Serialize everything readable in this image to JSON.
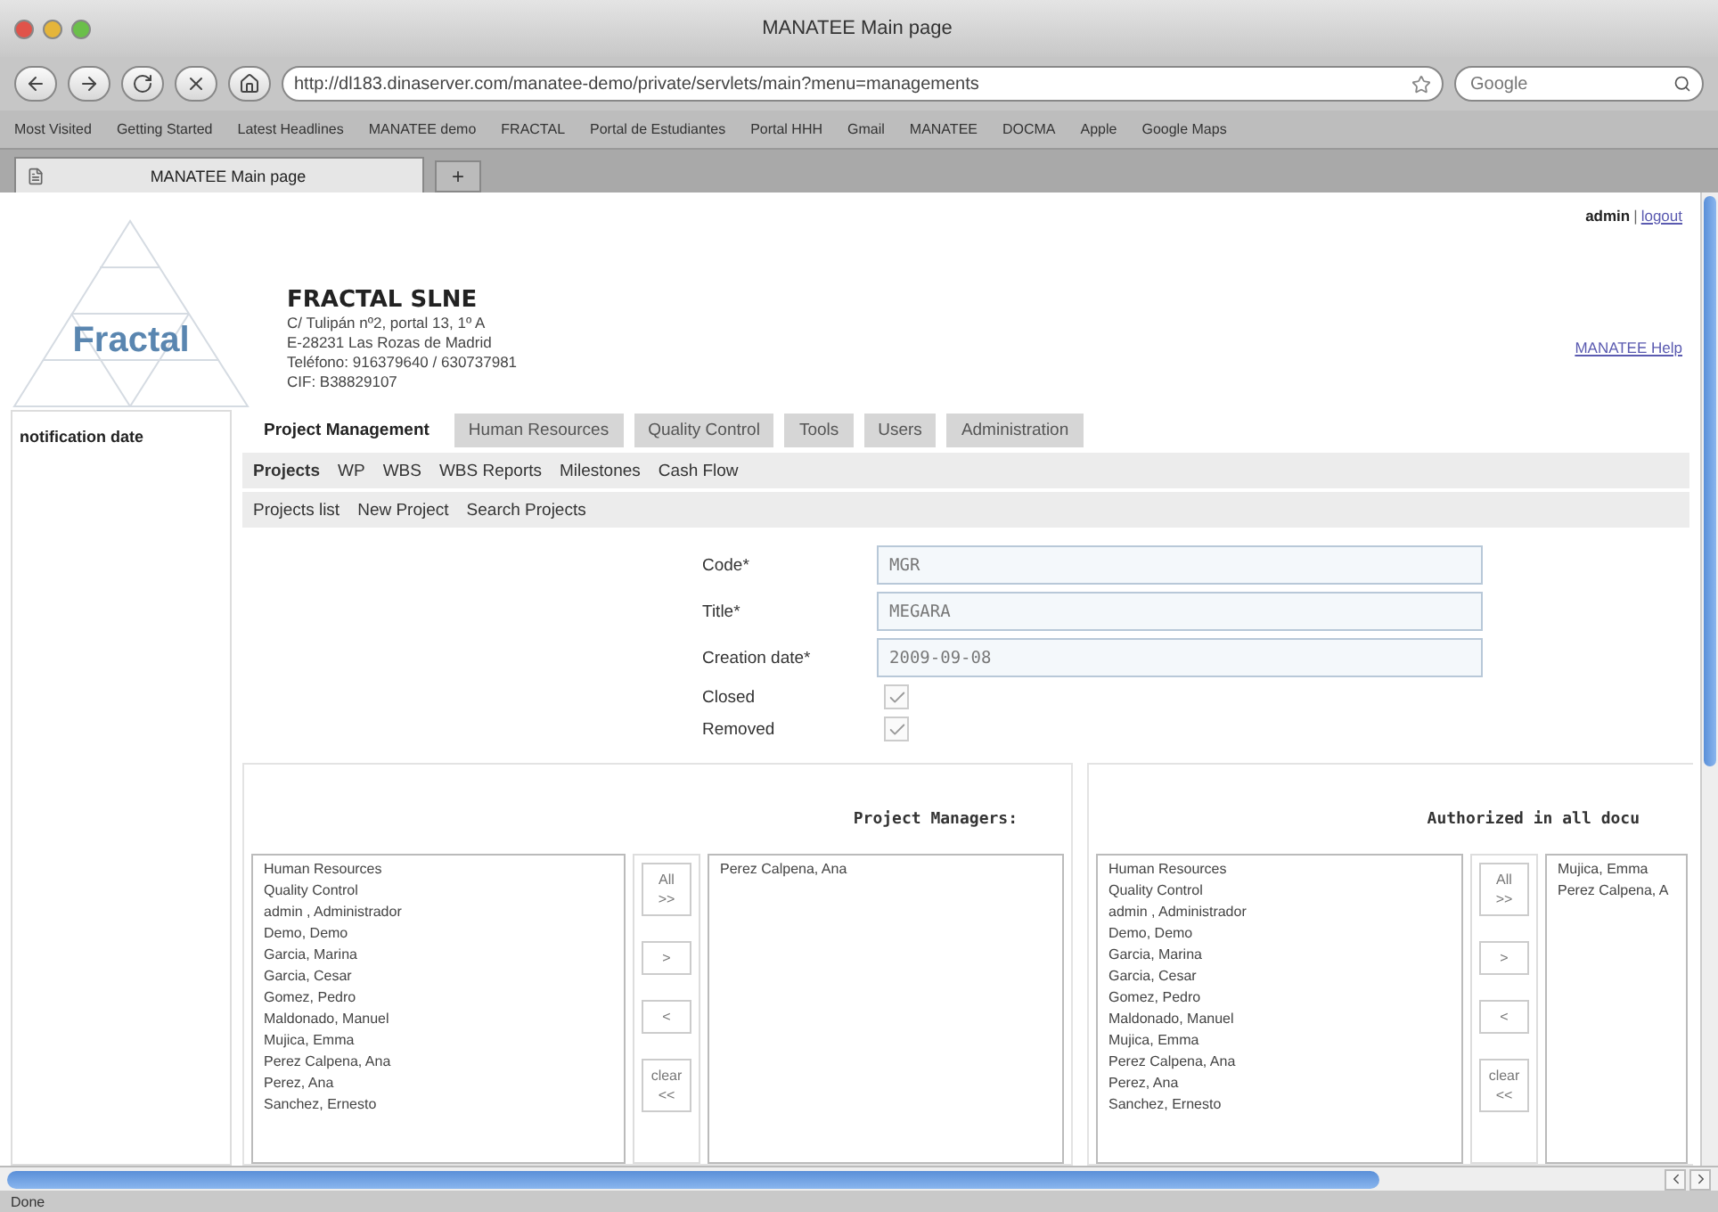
{
  "window": {
    "title": "MANATEE Main page"
  },
  "toolbar": {
    "url": "http://dl183.dinaserver.com/manatee-demo/private/servlets/main?menu=managements",
    "search_placeholder": "Google"
  },
  "bookmarks": [
    "Most Visited",
    "Getting Started",
    "Latest Headlines",
    "MANATEE demo",
    "FRACTAL",
    "Portal de Estudiantes",
    "Portal HHH",
    "Gmail",
    "MANATEE",
    "DOCMA",
    "Apple",
    "Google Maps"
  ],
  "tabs": [
    {
      "label": "MANATEE Main page",
      "selected": true
    }
  ],
  "new_tab": "+",
  "header": {
    "user": "admin",
    "separator": "|",
    "logout": "logout",
    "logo": "Fractal",
    "company": "FRACTAL SLNE",
    "address": [
      "C/ Tulipán nº2, portal 13, 1º A",
      "E-28231 Las Rozas de Madrid",
      "Teléfono: 916379640 / 630737981",
      "CIF: B38829107"
    ],
    "help": "MANATEE Help"
  },
  "sidebar": {
    "title": "notification date"
  },
  "main_tabs": [
    {
      "label": "Project Management",
      "selected": true
    },
    {
      "label": "Human Resources",
      "selected": false
    },
    {
      "label": "Quality Control",
      "selected": false
    },
    {
      "label": "Tools",
      "selected": false
    },
    {
      "label": "Users",
      "selected": false
    },
    {
      "label": "Administration",
      "selected": false
    }
  ],
  "sub_nav": [
    {
      "label": "Projects",
      "selected": true
    },
    {
      "label": "WP",
      "selected": false
    },
    {
      "label": "WBS",
      "selected": false
    },
    {
      "label": "WBS Reports",
      "selected": false
    },
    {
      "label": "Milestones",
      "selected": false
    },
    {
      "label": "Cash Flow",
      "selected": false
    }
  ],
  "actions": [
    "Projects list",
    "New Project",
    "Search Projects"
  ],
  "form": {
    "fields": [
      {
        "label": "Code*",
        "value": "MGR"
      },
      {
        "label": "Title*",
        "value": "MEGARA"
      },
      {
        "label": "Creation date*",
        "value": "2009-09-08"
      }
    ],
    "checkboxes": [
      {
        "label": "Closed",
        "checked": true
      },
      {
        "label": "Removed",
        "checked": true
      }
    ]
  },
  "panels": [
    {
      "title": "Project Managers:",
      "available": [
        "Human Resources",
        "Quality Control",
        "admin , Administrador",
        "Demo, Demo",
        "Garcia, Marina",
        "Garcia, Cesar",
        "Gomez, Pedro",
        "Maldonado, Manuel",
        "Mujica, Emma",
        "Perez Calpena, Ana",
        "Perez, Ana",
        "Sanchez, Ernesto"
      ],
      "buttons": [
        [
          "All",
          ">>"
        ],
        [
          ">"
        ],
        [
          "<"
        ],
        [
          "clear",
          "<<"
        ]
      ],
      "selected": [
        "Perez Calpena, Ana"
      ]
    },
    {
      "title": "Authorized in all docu",
      "available": [
        "Human Resources",
        "Quality Control",
        "admin , Administrador",
        "Demo, Demo",
        "Garcia, Marina",
        "Garcia, Cesar",
        "Gomez, Pedro",
        "Maldonado, Manuel",
        "Mujica, Emma",
        "Perez Calpena, Ana",
        "Perez, Ana",
        "Sanchez, Ernesto"
      ],
      "buttons": [
        [
          "All",
          ">>"
        ],
        [
          ">"
        ],
        [
          "<"
        ],
        [
          "clear",
          "<<"
        ]
      ],
      "selected": [
        "Mujica, Emma",
        "Perez Calpena, A"
      ]
    }
  ],
  "status_bar": "Done"
}
